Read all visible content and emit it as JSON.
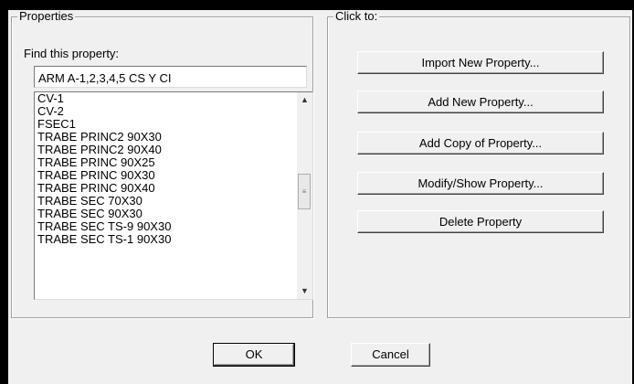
{
  "properties_group": {
    "title": "Properties",
    "find_label": "Find this property:",
    "find_value": "ARM A-1,2,3,4,5 CS Y CI",
    "list_items": [
      "CV-1",
      "CV-2",
      "FSEC1",
      "TRABE PRINC2 90X30",
      "TRABE PRINC2 90X40",
      "TRABE PRINC 90X25",
      "TRABE PRINC 90X30",
      "TRABE PRINC 90X40",
      "TRABE SEC 70X30",
      "TRABE SEC 90X30",
      "TRABE SEC  TS-9 90X30",
      "TRABE SEC TS-1 90X30"
    ],
    "scroll": {
      "up_glyph": "▲",
      "down_glyph": "▼",
      "thumb_glyph": "≡"
    }
  },
  "actions_group": {
    "title": "Click to:",
    "buttons": [
      "Import New Property...",
      "Add New Property...",
      "Add Copy of Property...",
      "Modify/Show Property...",
      "Delete Property"
    ]
  },
  "footer": {
    "ok_label": "OK",
    "cancel_label": "Cancel"
  }
}
